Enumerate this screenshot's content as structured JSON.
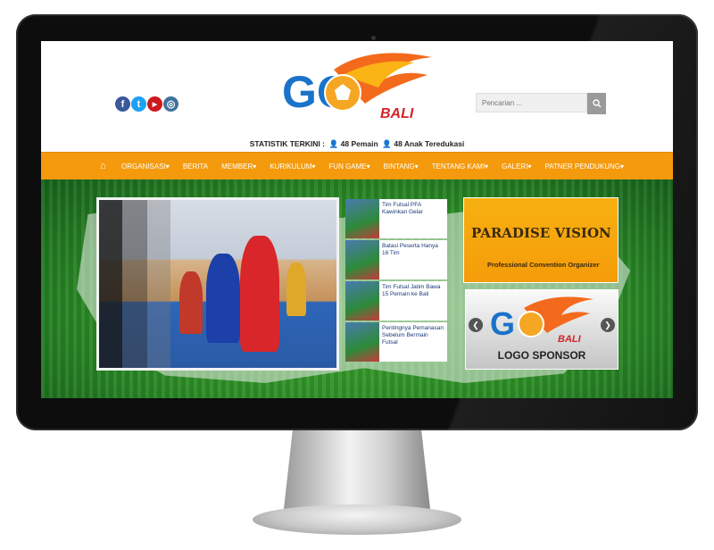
{
  "header": {
    "social": [
      {
        "icon": "facebook-icon",
        "glyph": "f",
        "color": "#3b5998"
      },
      {
        "icon": "twitter-icon",
        "glyph": "t",
        "color": "#1da1f2"
      },
      {
        "icon": "youtube-icon",
        "glyph": "▶",
        "color": "#cc181e"
      },
      {
        "icon": "instagram-icon",
        "glyph": "◎",
        "color": "#3f729b"
      }
    ],
    "logo": {
      "main": "GO",
      "sub": "BALI"
    },
    "search_placeholder": "Pencarian ...",
    "search_icon": "search-icon"
  },
  "stats": {
    "label": "STATISTIK TERKINI :",
    "players": "48 Pemain",
    "children": "48 Anak Teredukasi"
  },
  "nav": {
    "home_icon": "home-icon",
    "items": [
      "ORGANISASI▾",
      "BERITA",
      "MEMBER▾",
      "KURIKULUM▾",
      "FUN GAME▾",
      "BINTANG▾",
      "TENTANG KAMI▾",
      "GALERI▾",
      "PATNER PENDUKUNG▾"
    ]
  },
  "news": [
    "Tim Futsal PFA Kawinkan Gelar",
    "Batasi Peserta Hanya 16 Tim",
    "Tim Futsal Jatim Bawa 15 Pemain ke Bali",
    "Pentingnya Pemanasan Sebelum Bermain Futsal"
  ],
  "ads": {
    "ad1_title": "PARADISE VISION",
    "ad1_sub": "Professional Convention Organizer",
    "ad2_label": "LOGO SPONSOR"
  },
  "colors": {
    "nav": "#f59a0c",
    "brand": "#1a73c9"
  }
}
